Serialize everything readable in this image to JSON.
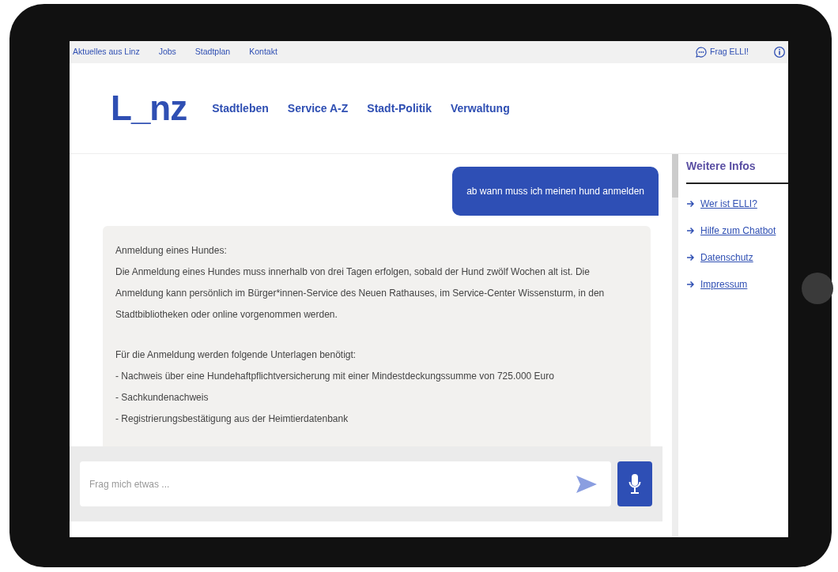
{
  "top_bar": {
    "links": [
      "Aktuelles aus Linz",
      "Jobs",
      "Stadtplan",
      "Kontakt"
    ],
    "chat_link": "Frag ELLI!"
  },
  "header": {
    "logo": "L_nz",
    "nav": [
      "Stadtleben",
      "Service A-Z",
      "Stadt-Politik",
      "Verwaltung"
    ]
  },
  "chat": {
    "messages": [
      {
        "kind": "user",
        "text": "ab wann muss ich meinen hund anmelden"
      },
      {
        "kind": "bot",
        "blocks": [
          [
            "Anmeldung eines Hundes:",
            "Die Anmeldung eines Hundes muss innerhalb von drei Tagen erfolgen, sobald der Hund zwölf Wochen alt ist. Die Anmeldung kann persönlich im Bürger*innen-Service des Neuen Rathauses, im Service-Center Wissensturm, in den Stadtbibliotheken oder online vorgenommen werden."
          ],
          [
            "Für die Anmeldung werden folgende Unterlagen benötigt:",
            "- Nachweis über eine Hundehaftpflichtversicherung mit einer Mindestdeckungssumme von 725.000 Euro",
            "- Sachkundenachweis",
            "- Registrierungsbestätigung aus der Heimtierdatenbank"
          ]
        ]
      }
    ],
    "input": {
      "placeholder": "Frag mich etwas ..."
    }
  },
  "sidebar": {
    "title": "Weitere Infos",
    "links": [
      "Wer ist ELLI?",
      "Hilfe zum Chatbot",
      "Datenschutz",
      "Impressum"
    ]
  }
}
